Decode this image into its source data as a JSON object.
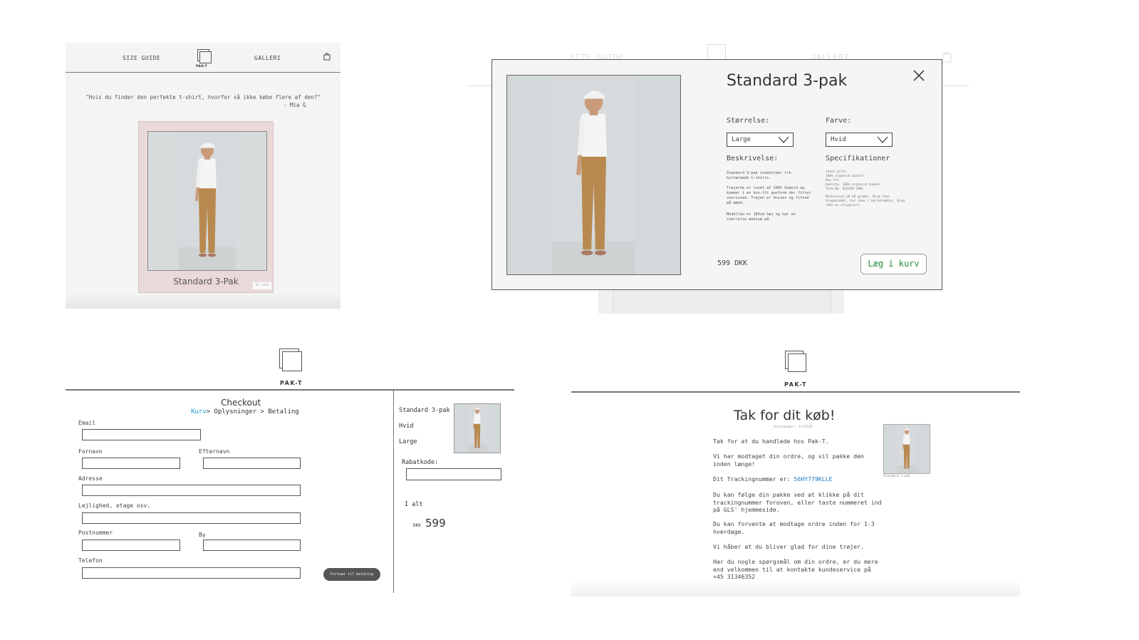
{
  "listing": {
    "nav": {
      "size_guide": "SIZE GUIDE",
      "logo_label": "PAK-T",
      "galleri": "GALLERI",
      "cart_icon": "bag-icon"
    },
    "quote": "\"Hvis du finder den perfekte t-shirt, hvorfor så ikke købe flere af den?\"",
    "quote_author": "- Mia G",
    "card": {
      "title": "Standard 3-Pak",
      "info_label": "Se info"
    }
  },
  "modal_backdrop": {
    "size_guide": "SIZE GUIDE",
    "galleri": "GALLERI"
  },
  "modal": {
    "title": "Standard 3-pak",
    "size_label": "Størrelse:",
    "size_value": "Large",
    "color_label": "Farve:",
    "color_value": "Hvid",
    "description_label": "Beskrivelse:",
    "description": [
      "Standard 3-pak indeholder tre kortærmede t-shirts.",
      "Trøjerne er lavet af 100% bomuld og kommer i en box-fit pasform der fitter oversized. Trøjen er Unisex og fitted på mænd.",
      "Modellen er 185cm høj og har en størrelse medium på."
    ],
    "spec_label": "Specifikationer",
    "specs": [
      "Intet print",
      "100% organisk bomuld",
      "Box fit",
      "Quality: 100% organisk bomuld",
      "Item No. 010288-2001",
      "Maskinvask på 40 grader. Brug ikke blegemiddel. Put ikke i tørretumbler. Brug ikke en strygejern."
    ],
    "price": "599 DKK",
    "add_to_cart": "Læg i kurv",
    "close_icon": "close-icon"
  },
  "checkout": {
    "brand": "PAK-T",
    "heading": "Checkout",
    "breadcrumb": {
      "kurv": "Kurv",
      "rest": "> Oplysninger > Betaling"
    },
    "fields": {
      "email": "Email",
      "fornavn": "Fornavn",
      "efternavn": "Efternavn",
      "adresse": "Adresse",
      "lejlighed": "Lejlighed, etage osv.",
      "postnummer": "Postnummer",
      "by": "By",
      "telefon": "Telefon"
    },
    "continue_button": "Fortsæt til betaling",
    "summary": {
      "product": "Standard 3-pak",
      "color": "Hvid",
      "size": "Large",
      "discount_label": "Rabatkode:",
      "total_label": "I alt",
      "currency": "DKK",
      "total": "599"
    }
  },
  "confirmation": {
    "brand": "PAK-T",
    "heading": "Tak for dit køb!",
    "order_number": "Ordrenummer: 1121520",
    "p1": "Tak for at du handlede hos Pak-T.",
    "p2": "Vi har modtaget din ordre, og vil pakke den inden længe!",
    "tracking_prefix": "Dit Trackingnummer er: ",
    "tracking_number": "56HY779KLLE",
    "p4": "Du kan følge din pakke ved at klikke på dit trackingnummer foroven, eller taste nummeret ind på GLS' hjemmeside.",
    "p5": "Du kan forvente at modtage ordre inden for 1-3 hverdage.",
    "p6": "Vi håber at du bliver glad for dine trøjer.",
    "p7": "Har du nogle spørgsmål om din ordre, er du mere end velkommen til at kontakte kundeservice på +45 31346352",
    "thumb_caption": "Standard 3-pak"
  }
}
